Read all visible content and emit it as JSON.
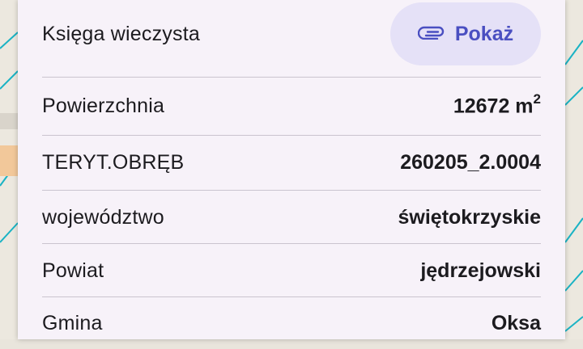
{
  "colors": {
    "panel_bg": "#f7f2f9",
    "accent": "#4a4fc1",
    "button_bg": "#e5e1f7",
    "divider": "#cac4cf",
    "map_parcel_line": "#1ab3c4"
  },
  "land_register": {
    "label": "Księga wieczysta",
    "button_label": "Pokaż",
    "button_icon": "paperclip-icon"
  },
  "area": {
    "label": "Powierzchnia",
    "value": "12672 m",
    "unit_exponent": "2"
  },
  "details": [
    {
      "label": "TERYT.OBRĘB",
      "value": "260205_2.0004"
    },
    {
      "label": "województwo",
      "value": "świętokrzyskie"
    },
    {
      "label": "Powiat",
      "value": "jędrzejowski"
    },
    {
      "label": "Gmina",
      "value": "Oksa"
    }
  ]
}
